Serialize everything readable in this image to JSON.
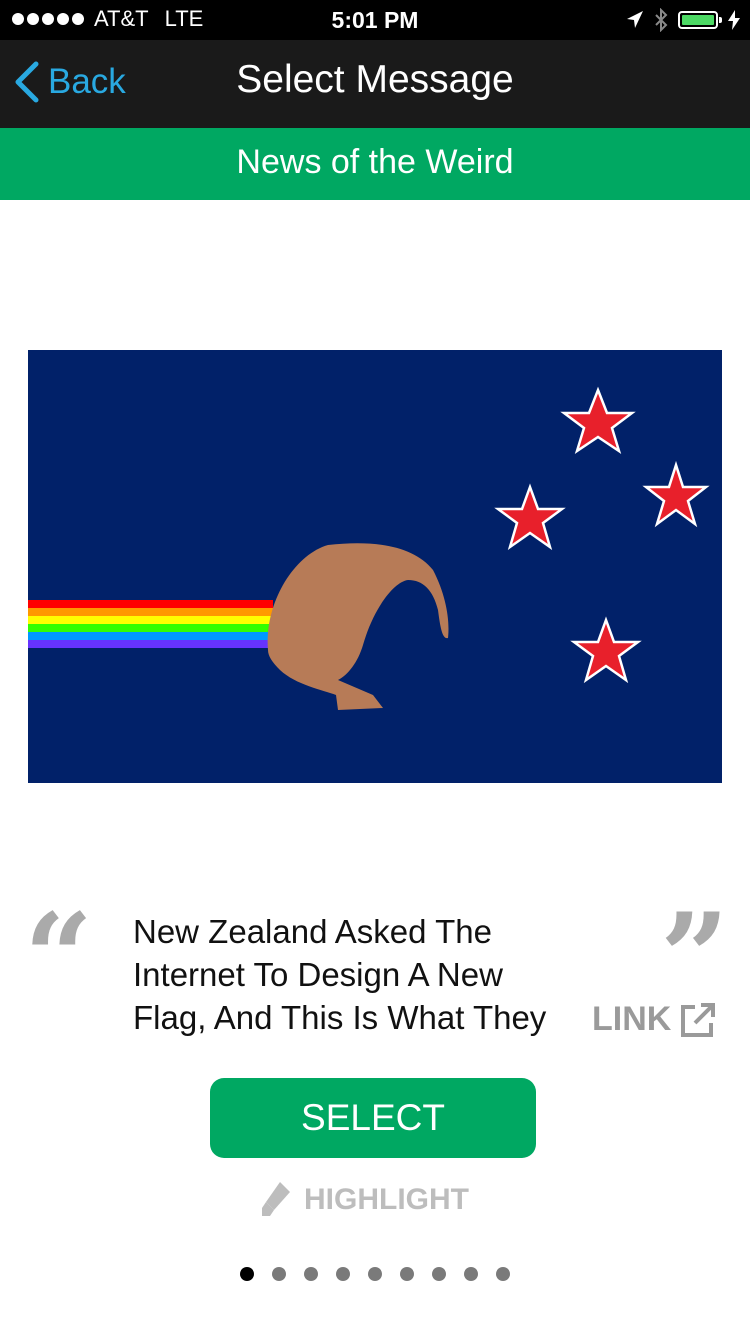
{
  "status_bar": {
    "carrier": "AT&T",
    "network": "LTE",
    "time": "5:01 PM"
  },
  "nav": {
    "back_label": "Back",
    "title": "Select Message"
  },
  "category": "News of the Weird",
  "article": {
    "headline": "New Zealand Asked The Internet To Design A New Flag, And This Is What They",
    "link_label": "LINK"
  },
  "actions": {
    "select_label": "SELECT",
    "highlight_label": "HIGHLIGHT"
  },
  "pager": {
    "page_count": 9,
    "active_index": 0
  },
  "colors": {
    "accent_green": "#00a862",
    "back_blue": "#29a9e1",
    "flag_blue": "#012169",
    "star_red": "#e8202b",
    "kiwi_brown": "#b77b57"
  },
  "icons": {
    "back": "chevron-left-icon",
    "link": "external-link-icon",
    "highlight": "highlighter-pen-icon"
  }
}
